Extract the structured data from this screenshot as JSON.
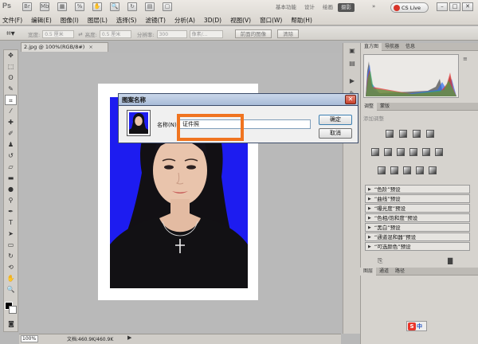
{
  "app": {
    "logo": "Ps",
    "title_icons": [
      "Br",
      "Mb",
      "zoom",
      "100%",
      "hand",
      "zoom-tool",
      "rotate",
      "arrange",
      "screen-mode"
    ]
  },
  "menu": [
    "文件(F)",
    "编辑(E)",
    "图像(I)",
    "图层(L)",
    "选择(S)",
    "滤镜(T)",
    "分析(A)",
    "3D(D)",
    "视图(V)",
    "窗口(W)",
    "帮助(H)"
  ],
  "workspaces": {
    "items": [
      "基本功能",
      "设计",
      "绘画",
      "摄影"
    ],
    "more": "»",
    "active": "摄影"
  },
  "cslive": "CS Live",
  "window_controls": [
    "–",
    "□",
    "✕"
  ],
  "options": {
    "width_label": "宽度:",
    "width_value": "0.5 厘米",
    "height_label": "高度:",
    "height_value": "0.5 厘米",
    "res_label": "分辨率:",
    "res_value": "300",
    "unit_value": "像素/...",
    "front_image_btn": "前面的图像",
    "clear_btn": "清除"
  },
  "document": {
    "tab_title": "2.jpg @ 100%(RGB/8#)",
    "tab_close": "×",
    "zoom": "100%",
    "info": "文档:460.9K/460.9K",
    "status_arrow": "▶"
  },
  "panels": {
    "top_tabs": [
      "直方图",
      "导航器",
      "信息"
    ],
    "adj_tabs": [
      "调整",
      "蒙版"
    ],
    "adj_title": "添加调整",
    "presets": [
      "“色阶”预设",
      "“曲线”预设",
      "“曝光度”预设",
      "“色相/饱和度”预设",
      "“黑白”预设",
      "“通道混和器”预设",
      "“可选颜色”预设"
    ],
    "layers_tabs": [
      "图层",
      "通道",
      "路径"
    ]
  },
  "ime": {
    "icon": "S",
    "lang": "中"
  },
  "dialog": {
    "title": "图案名称",
    "name_label": "名称(N):",
    "name_value": "证件照",
    "ok": "确定",
    "cancel": "取消"
  },
  "colors": {
    "photo_bg": "#1d1cf0",
    "highlight": "#f07420"
  }
}
